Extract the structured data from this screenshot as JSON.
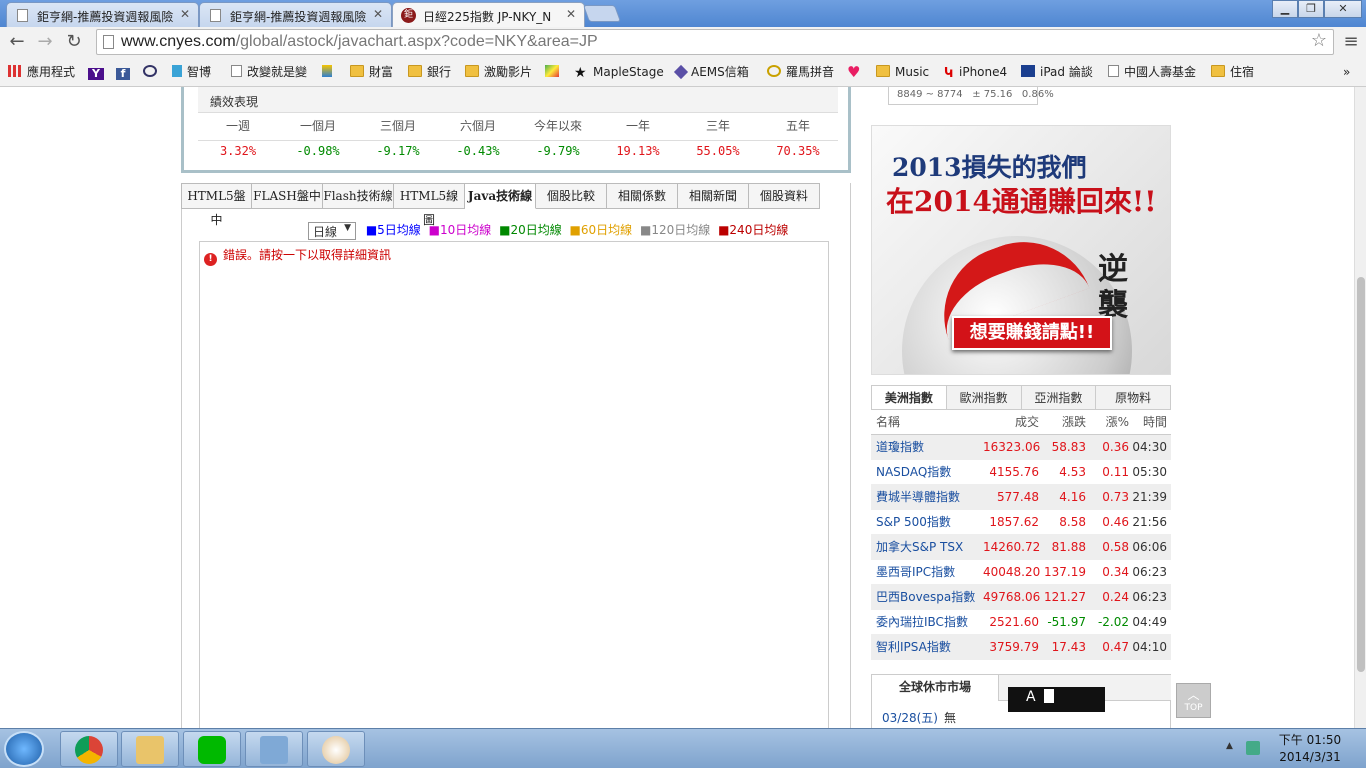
{
  "browser": {
    "tabs": [
      {
        "title": "鉅亨網-推薦投資週報風險"
      },
      {
        "title": "鉅亨網-推薦投資週報風險"
      },
      {
        "title": "日經225指數 JP-NKY_N"
      }
    ],
    "url_host": "www.cnyes.com",
    "url_path": "/global/astock/javachart.aspx?code=NKY&area=JP",
    "bookmarks": [
      "應用程式",
      "智博",
      "改變就是變",
      "財富",
      "銀行",
      "激勵影片",
      "MapleStage",
      "AEMS信箱",
      "羅馬拼音",
      "Music",
      "iPhone4",
      "iPad 論談",
      "中國人壽基金",
      "住宿"
    ],
    "more": "»"
  },
  "performance": {
    "title": "績效表現",
    "periods": [
      "一週",
      "一個月",
      "三個月",
      "六個月",
      "今年以來",
      "一年",
      "三年",
      "五年"
    ],
    "values": [
      "3.32%",
      "-0.98%",
      "-9.17%",
      "-0.43%",
      "-9.79%",
      "19.13%",
      "55.05%",
      "70.35%"
    ]
  },
  "chart_tabs": [
    "HTML5盤中",
    "FLASH盤中",
    "Flash技術線",
    "HTML5線圖",
    "Java技術線",
    "個股比較",
    "相關係數",
    "相關新聞",
    "個股資料"
  ],
  "ma": {
    "period": "日線",
    "lines": [
      {
        "label": "5日均線",
        "color": "#0000ff"
      },
      {
        "label": "10日均線",
        "color": "#cc00cc"
      },
      {
        "label": "20日均線",
        "color": "#008800"
      },
      {
        "label": "60日均線",
        "color": "#e0a000"
      },
      {
        "label": "120日均線",
        "color": "#888888"
      },
      {
        "label": "240日均線",
        "color": "#bb0000"
      }
    ]
  },
  "java_error": "錯誤。請按一下以取得詳細資訊",
  "mini_quote": {
    "range": "8849 ~ 8774",
    "change": "± 75.16",
    "pct": "0.86%"
  },
  "ad": {
    "line1": "2013損失的我們",
    "line2": "在2014通通賺回來!!",
    "vertical": "逆襲",
    "button": "想要賺錢請點!!"
  },
  "indices": {
    "tabs": [
      "美洲指數",
      "歐洲指數",
      "亞洲指數",
      "原物料"
    ],
    "headers": [
      "名稱",
      "成交",
      "漲跌",
      "漲%",
      "時間"
    ],
    "rows": [
      {
        "name": "道瓊指數",
        "value": "16323.06",
        "change": "58.83",
        "pct": "0.36",
        "time": "04:30"
      },
      {
        "name": "NASDAQ指數",
        "value": "4155.76",
        "change": "4.53",
        "pct": "0.11",
        "time": "05:30"
      },
      {
        "name": "費城半導體指數",
        "value": "577.48",
        "change": "4.16",
        "pct": "0.73",
        "time": "21:39"
      },
      {
        "name": "S&P 500指數",
        "value": "1857.62",
        "change": "8.58",
        "pct": "0.46",
        "time": "21:56"
      },
      {
        "name": "加拿大S&P TSX",
        "value": "14260.72",
        "change": "81.88",
        "pct": "0.58",
        "time": "06:06"
      },
      {
        "name": "墨西哥IPC指數",
        "value": "40048.20",
        "change": "137.19",
        "pct": "0.34",
        "time": "06:23"
      },
      {
        "name": "巴西Bovespa指數",
        "value": "49768.06",
        "change": "121.27",
        "pct": "0.24",
        "time": "06:23"
      },
      {
        "name": "委內瑞拉IBC指數",
        "value": "2521.60",
        "change": "-51.97",
        "pct": "-2.02",
        "time": "04:49"
      },
      {
        "name": "智利IPSA指數",
        "value": "3759.79",
        "change": "17.43",
        "pct": "0.47",
        "time": "04:10"
      }
    ]
  },
  "holiday": {
    "title": "全球休市市場",
    "date": "03/28(五)",
    "note": "無"
  },
  "ime": "A",
  "top_button": "TOP",
  "taskbar": {
    "time": "下午 01:50",
    "date": "2014/3/31"
  }
}
